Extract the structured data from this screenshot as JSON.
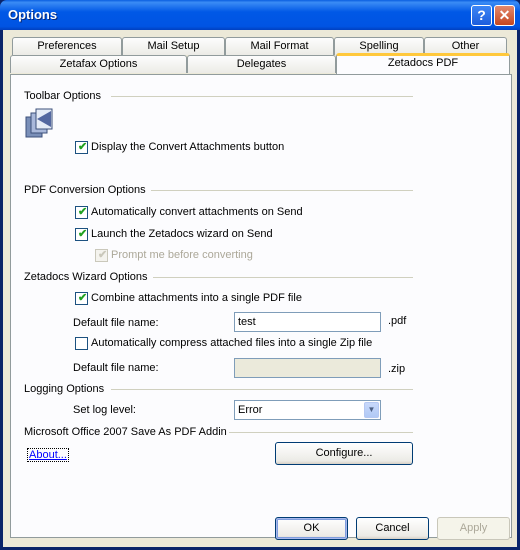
{
  "window": {
    "title": "Options",
    "help_glyph": "?",
    "close_glyph": "✕"
  },
  "tabs": {
    "row1": [
      "Preferences",
      "Mail Setup",
      "Mail Format",
      "Spelling",
      "Other"
    ],
    "row2": [
      "Zetafax Options",
      "Delegates",
      "Zetadocs PDF"
    ],
    "active": "Zetadocs PDF"
  },
  "toolbar_options": {
    "heading": "Toolbar Options",
    "display_convert": {
      "label": "Display the Convert Attachments button",
      "checked": true
    }
  },
  "pdf_conversion": {
    "heading": "PDF Conversion Options",
    "auto_convert": {
      "label": "Automatically convert attachments on Send",
      "checked": true
    },
    "launch_wizard": {
      "label": "Launch the Zetadocs wizard on Send",
      "checked": true
    },
    "prompt_before": {
      "label": "Prompt me before converting",
      "checked": true,
      "enabled": false
    }
  },
  "wizard_options": {
    "heading": "Zetadocs Wizard Options",
    "combine": {
      "label": "Combine attachments into a single PDF file",
      "checked": true
    },
    "default_file_name_label": "Default file name:",
    "default_file_name_value": "test",
    "pdf_ext": ".pdf",
    "compress": {
      "label": "Automatically compress attached files into a single Zip file",
      "checked": false
    },
    "zip_file_name_label": "Default file name:",
    "zip_file_name_value": "",
    "zip_ext": ".zip"
  },
  "logging": {
    "heading": "Logging Options",
    "log_level_label": "Set log level:",
    "log_level_value": "Error"
  },
  "office_addin": {
    "heading": "Microsoft Office 2007 Save As PDF Addin",
    "about_label": "About...",
    "configure_label": "Configure..."
  },
  "buttons": {
    "ok": "OK",
    "cancel": "Cancel",
    "apply": "Apply"
  },
  "check_glyph": "✔",
  "arrow_glyph": "▼"
}
